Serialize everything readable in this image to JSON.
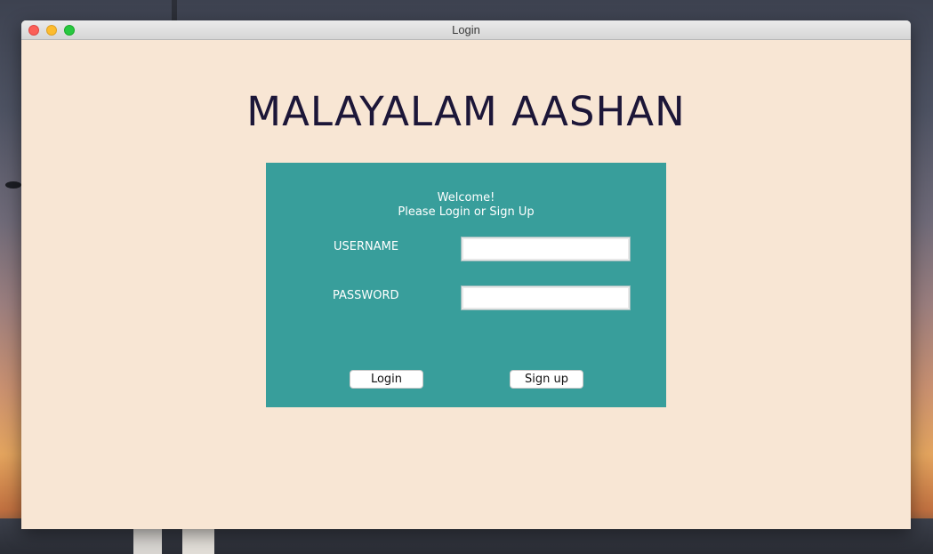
{
  "window": {
    "title": "Login"
  },
  "app": {
    "title": "MALAYALAM AASHAN"
  },
  "login_panel": {
    "welcome_line1": "Welcome!",
    "welcome_line2": "Please Login or Sign Up",
    "username_label": "USERNAME",
    "username_value": "",
    "password_label": "PASSWORD",
    "password_value": "",
    "login_button": "Login",
    "signup_button": "Sign up"
  },
  "colors": {
    "window_background": "#f8e6d4",
    "panel_background": "#389e9b",
    "title_color": "#1c1638",
    "panel_text": "#ffffff"
  },
  "icons": {
    "close": "close-icon",
    "minimize": "minimize-icon",
    "maximize": "maximize-icon"
  }
}
